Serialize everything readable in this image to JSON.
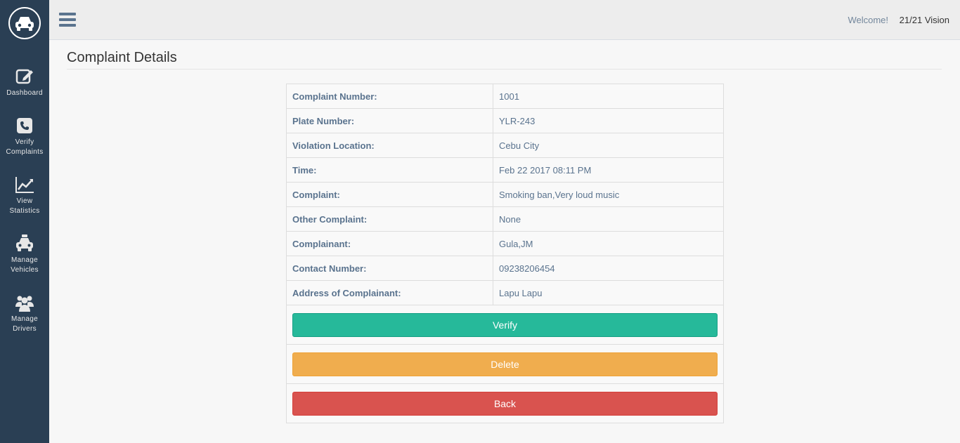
{
  "colors": {
    "sidebar_bg": "#2a3f54",
    "verify": "#26b99a",
    "delete": "#f0ad4e",
    "back": "#d9534f"
  },
  "sidebar": {
    "logo_icon": "car-icon",
    "items": [
      {
        "label": "Dashboard",
        "icon": "edit-icon"
      },
      {
        "label": "Verify\nComplaints",
        "icon": "phone-icon"
      },
      {
        "label": "View\nStatistics",
        "icon": "line-chart-icon"
      },
      {
        "label": "Manage\nVehicles",
        "icon": "taxi-icon"
      },
      {
        "label": "Manage\nDrivers",
        "icon": "users-icon"
      }
    ]
  },
  "topbar": {
    "menu_icon": "hamburger-icon",
    "welcome": "Welcome!",
    "username": "21/21 Vision"
  },
  "page": {
    "title": "Complaint Details"
  },
  "details": [
    {
      "label": "Complaint Number:",
      "value": "1001"
    },
    {
      "label": "Plate Number:",
      "value": "YLR-243"
    },
    {
      "label": "Violation Location:",
      "value": "Cebu City"
    },
    {
      "label": "Time:",
      "value": "Feb 22 2017 08:11 PM"
    },
    {
      "label": "Complaint:",
      "value": "Smoking ban,Very loud music"
    },
    {
      "label": "Other Complaint:",
      "value": "None"
    },
    {
      "label": "Complainant:",
      "value": "Gula,JM"
    },
    {
      "label": "Contact Number:",
      "value": "09238206454"
    },
    {
      "label": "Address of Complainant:",
      "value": "Lapu Lapu"
    }
  ],
  "actions": {
    "verify": "Verify",
    "delete": "Delete",
    "back": "Back"
  }
}
